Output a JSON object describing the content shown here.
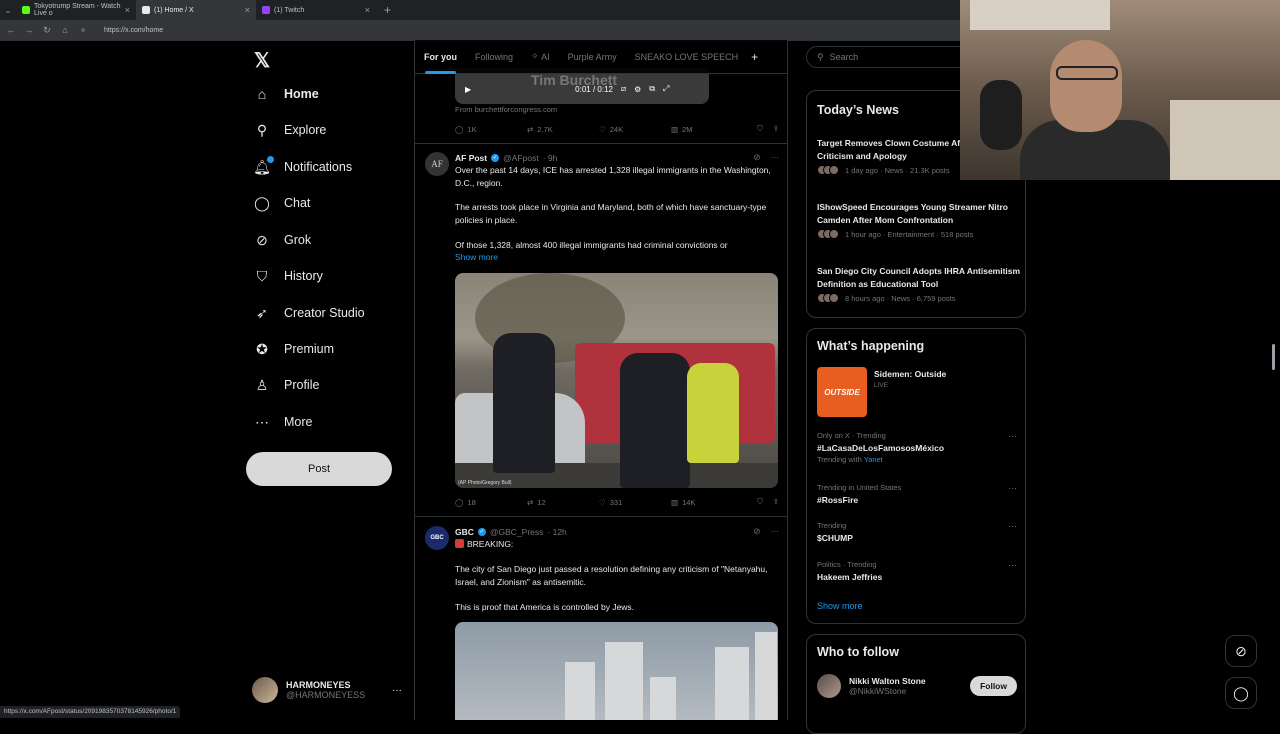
{
  "browser": {
    "tabs": [
      {
        "label": "Tokyotrump Stream - Watch Live o",
        "fav_color": "#53fc18"
      },
      {
        "label": "(1) Home / X",
        "fav_color": "#e7e9ea"
      },
      {
        "label": "(1) Twitch",
        "fav_color": "#9146ff"
      }
    ],
    "url": "https://x.com/home",
    "status_url": "https://x.com/AFpost/status/2091983570378145926/photo/1"
  },
  "nav": {
    "items": [
      {
        "label": "Home",
        "icon": "home-icon"
      },
      {
        "label": "Explore",
        "icon": "search-icon"
      },
      {
        "label": "Notifications",
        "icon": "bell-icon"
      },
      {
        "label": "Chat",
        "icon": "chat-icon"
      },
      {
        "label": "Grok",
        "icon": "grok-icon"
      },
      {
        "label": "History",
        "icon": "bookmark-icon"
      },
      {
        "label": "Creator Studio",
        "icon": "rocket-icon"
      },
      {
        "label": "Premium",
        "icon": "verified-icon"
      },
      {
        "label": "Profile",
        "icon": "person-icon"
      },
      {
        "label": "More",
        "icon": "more-circle-icon"
      }
    ],
    "post_label": "Post",
    "account": {
      "name": "HARMONEYES",
      "handle": "@HARMONEYESS"
    }
  },
  "feed": {
    "tabs": [
      "For you",
      "Following",
      "AI",
      "Purple Army",
      "SNEAKO LOVE SPEECH"
    ],
    "video": {
      "title": "Tim Burchett",
      "time": "0:01 / 0:12",
      "source": "From burchettforcongress.com"
    },
    "video_actions": {
      "replies": "1K",
      "reposts": "2.7K",
      "likes": "24K",
      "views": "2M"
    },
    "tweet1": {
      "avatar": "AF",
      "name": "AF Post",
      "handle": "@AFpost",
      "time": "· 9h",
      "paragraphs": [
        "Over the past 14 days, ICE has arrested 1,328 illegal immigrants in the Washington, D.C., region.",
        "The arrests took place in Virginia and Maryland, both of which have sanctuary-type policies in place.",
        "Of those 1,328, almost 400 illegal immigrants had criminal convictions or"
      ],
      "show_more": "Show more",
      "photo_credit": "(AP Photo/Gregory Bull)",
      "actions": {
        "replies": "18",
        "reposts": "12",
        "likes": "331",
        "views": "14K"
      }
    },
    "tweet2": {
      "avatar": "GBC",
      "name": "GBC",
      "handle": "@GBC_Press",
      "time": "· 12h",
      "paragraphs": [
        "BREAKING:",
        "The city of San Diego just passed a resolution defining any criticism of \"Netanyahu, Israel, and Zionism\" as antisemitic.",
        "This is proof that America is controlled by Jews."
      ]
    }
  },
  "sidebar": {
    "search_placeholder": "Search",
    "news_title": "Today’s News",
    "news": [
      {
        "headline": "Target Removes Clown Costume After Blackface Criticism and Apology",
        "meta": "1 day ago · News · 21.3K posts"
      },
      {
        "headline": "IShowSpeed Encourages Young Streamer Nitro Camden After Mom Confrontation",
        "meta": "1 hour ago · Entertainment · 518 posts"
      },
      {
        "headline": "San Diego City Council Adopts IHRA Antisemitism Definition as Educational Tool",
        "meta": "8 hours ago · News · 6,759 posts"
      }
    ],
    "happening_title": "What’s happening",
    "live": {
      "title": "Sidemen: Outside",
      "sub": "LIVE",
      "thumb": "OUTSIDE"
    },
    "trends": [
      {
        "category": "Only on X · Trending",
        "title": "#LaCasaDeLosFamososMéxico",
        "sub": "Trending with",
        "sub_link": "Yanet"
      },
      {
        "category": "Trending in United States",
        "title": "#RossFire",
        "sub": "",
        "sub_link": ""
      },
      {
        "category": "Trending",
        "title": "$CHUMP",
        "sub": "",
        "sub_link": ""
      },
      {
        "category": "Politics · Trending",
        "title": "Hakeem Jeffries",
        "sub": "",
        "sub_link": ""
      }
    ],
    "show_more": "Show more",
    "wtf_title": "Who to follow",
    "wtf": {
      "name": "Nikki Walton Stone",
      "handle": "@NikkiWStone",
      "button": "Follow"
    }
  }
}
